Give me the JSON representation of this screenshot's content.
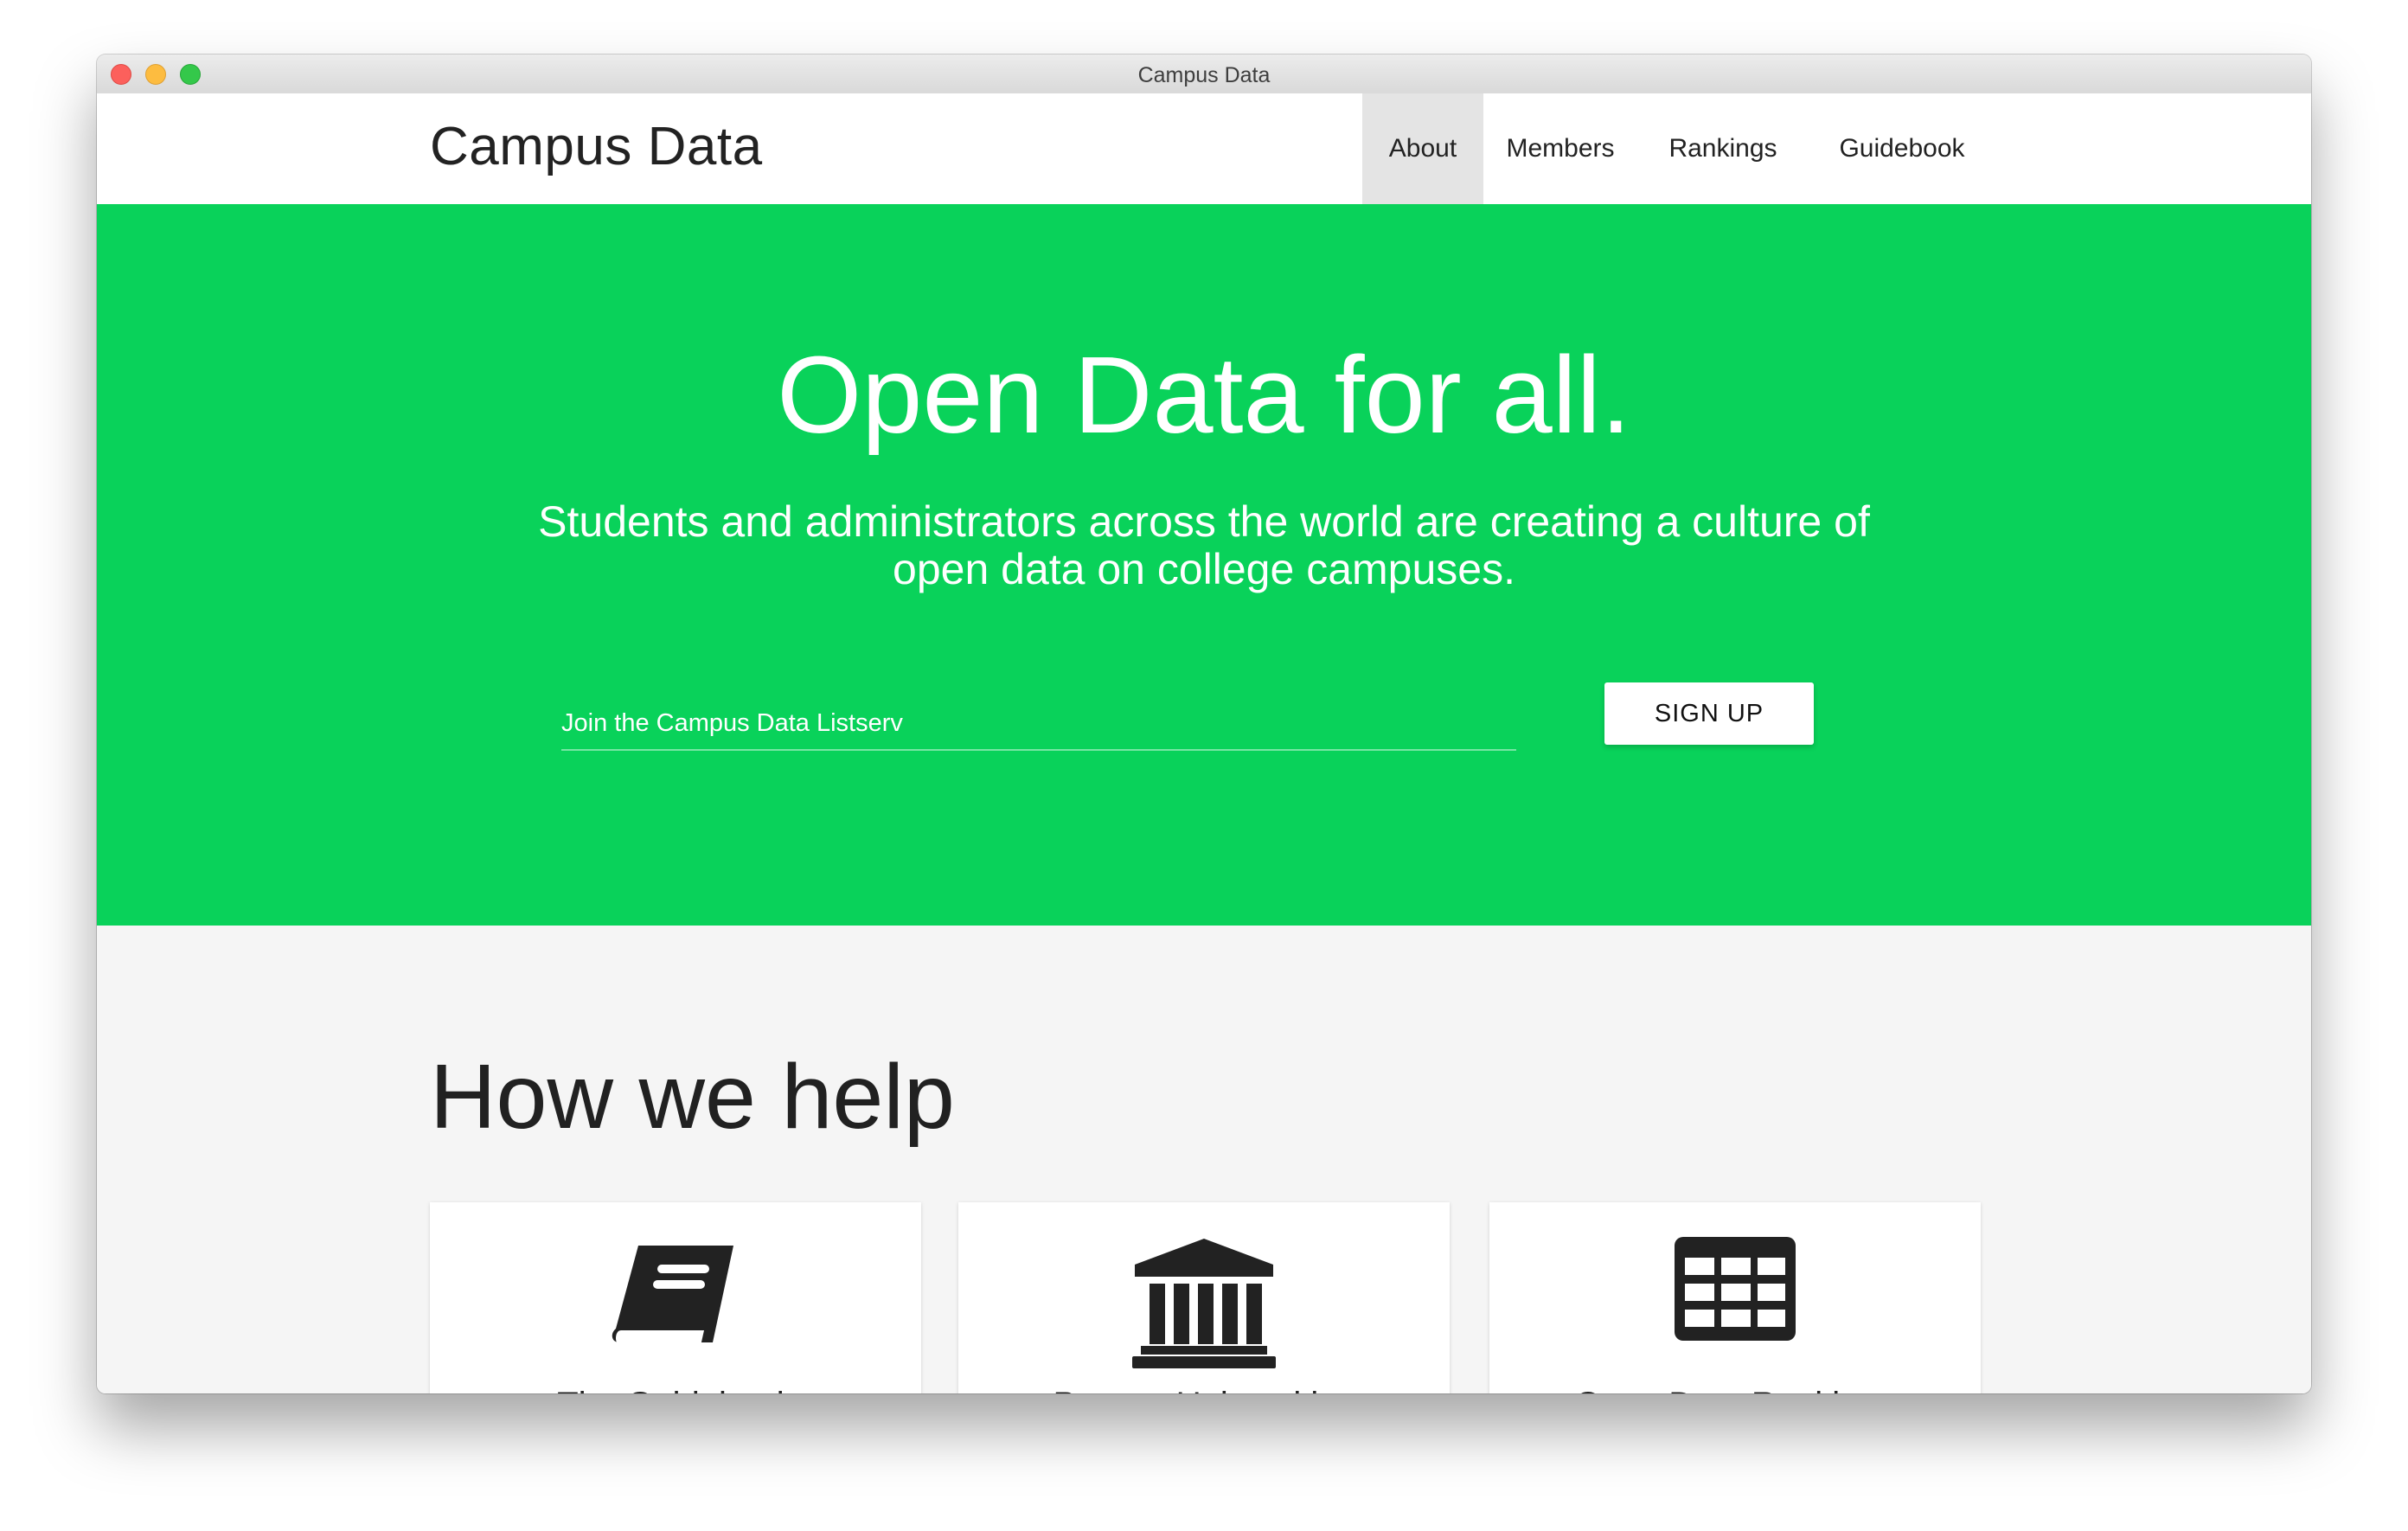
{
  "window": {
    "title": "Campus Data"
  },
  "navbar": {
    "brand": "Campus Data",
    "items": [
      {
        "label": "About",
        "active": true
      },
      {
        "label": "Members",
        "active": false
      },
      {
        "label": "Rankings",
        "active": false
      },
      {
        "label": "Guidebook",
        "active": false
      }
    ]
  },
  "hero": {
    "title": "Open Data for all.",
    "subtitle": "Students and administrators across the world are creating a culture of open data on college campuses.",
    "input_placeholder": "Join the Campus Data Listserv",
    "input_value": "",
    "signup_label": "SIGN UP",
    "background_color": "#09d25a"
  },
  "help": {
    "heading": "How we help",
    "cards": [
      {
        "icon": "book-icon",
        "title": "The Guidebook"
      },
      {
        "icon": "university-icon",
        "title": "Partner Universities"
      },
      {
        "icon": "table-icon",
        "title": "Open Data Rankings"
      }
    ]
  }
}
